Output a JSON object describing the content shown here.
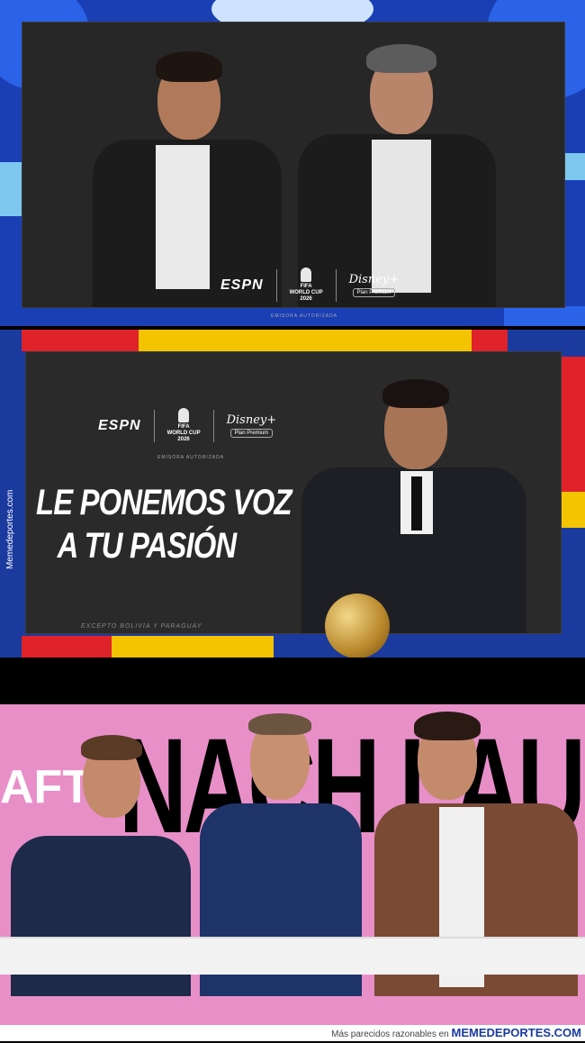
{
  "panel1": {
    "logos": {
      "espn": "ESPN",
      "fifa_line1": "FIFA",
      "fifa_line2": "WORLD CUP",
      "fifa_line3": "2026",
      "disney": "Disney+",
      "plan": "Plan Premium"
    },
    "emisora": "EMISORA AUTORIZADA",
    "colors": {
      "background": "#1a3fb5",
      "card": "#272727"
    }
  },
  "panel2": {
    "logos": {
      "espn": "ESPN",
      "fifa_line1": "FIFA",
      "fifa_line2": "WORLD CUP",
      "fifa_line3": "2026",
      "disney": "Disney+",
      "plan": "Plan Premium"
    },
    "emisora": "EMISORA AUTORIZADA",
    "slogan_line1": "LE PONEMOS VOZ",
    "slogan_line2": "A TU PASIÓN",
    "excepto": "EXCEPTO BOLIVIA Y PARAGUAY",
    "colors": {
      "background": "#1b3a9e",
      "card": "#2a2a2a",
      "red": "#e0222a",
      "yellow": "#f5c400"
    }
  },
  "watermark_vertical": "Memedeportes.com",
  "panel3": {
    "text_left": "AFT",
    "text_main": "NACH LAU",
    "colors": {
      "background": "#e88fc8"
    }
  },
  "footer": {
    "text": "Más parecidos razonables en",
    "brand": "MEMEDEPORTES.COM"
  }
}
